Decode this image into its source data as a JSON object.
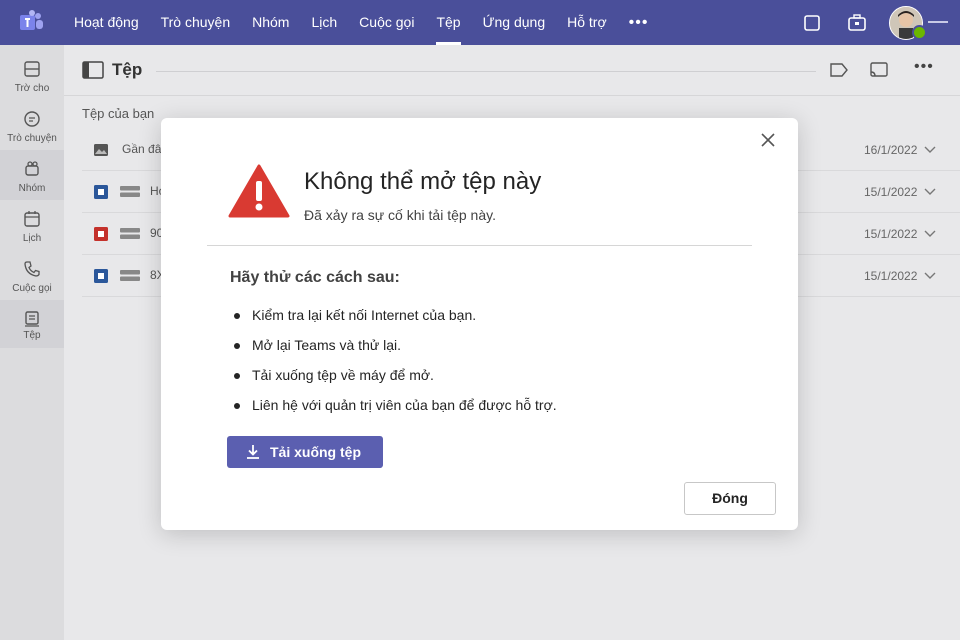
{
  "topbar": {
    "nav": [
      "Hoạt động",
      "Trò chuyện",
      "Nhóm",
      "Lịch",
      "Cuộc gọi",
      "Tệp",
      "Ứng dụng",
      "Hỗ trợ"
    ],
    "active_nav": "Tệp",
    "more": "•••",
    "bg_color": "#4a4f9a"
  },
  "rail": {
    "items": [
      {
        "label": "Trờ cho",
        "icon": "activity-icon"
      },
      {
        "label": "Trò chuyện",
        "icon": "chat-icon"
      },
      {
        "label": "Nhóm",
        "icon": "teams-icon"
      },
      {
        "label": "Lịch",
        "icon": "calendar-icon"
      },
      {
        "label": "Cuộc gọi",
        "icon": "phone-icon"
      },
      {
        "label": "Tệp",
        "icon": "file-icon"
      }
    ]
  },
  "files": {
    "title": "Tệp",
    "section": "Tệp của bạn",
    "rows": [
      {
        "name": "Gần đây",
        "date": "16/1/2022"
      },
      {
        "name": "Ho",
        "date": "15/1/2022"
      },
      {
        "name": "90",
        "date": "15/1/2022"
      },
      {
        "name": "8X",
        "date": "15/1/2022"
      }
    ]
  },
  "dialog": {
    "title": "Không thể mở tệp này",
    "subtitle": "Đã xảy ra sự cố khi tải tệp này.",
    "try_heading": "Hãy thử các cách sau:",
    "tips": [
      "Kiểm tra lại kết nối Internet của bạn.",
      "Mở lại Teams và thử lại.",
      "Tải xuống tệp về máy để mở.",
      "Liên hệ với quản trị viên của bạn để được hỗ trợ."
    ],
    "download_label": "Tải xuống tệp",
    "close_label": "Đóng",
    "accent_color": "#5b5fb0",
    "warning_color": "#d93a32"
  }
}
